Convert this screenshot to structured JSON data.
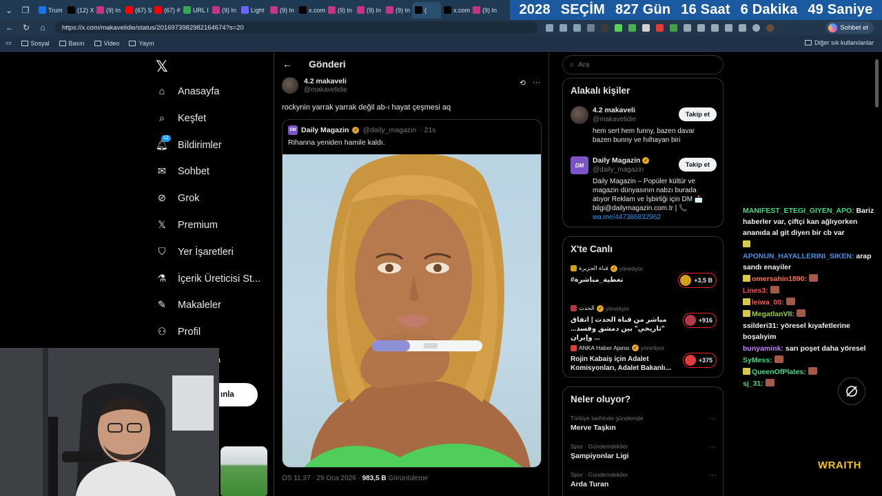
{
  "browser": {
    "tabs": [
      {
        "label": "Trum",
        "color": "#1a73e8",
        "icon": "news-icon"
      },
      {
        "label": "(12) X",
        "color": "#000000",
        "icon": "x-icon"
      },
      {
        "label": "(9) In",
        "color": "#c13584",
        "icon": "instagram-icon"
      },
      {
        "label": "(67) S",
        "color": "#ff0000",
        "icon": "youtube-icon"
      },
      {
        "label": "(67) #",
        "color": "#ff0000",
        "icon": "youtube-icon"
      },
      {
        "label": "URL I",
        "color": "#34a853",
        "icon": "url-icon"
      },
      {
        "label": "(9) In",
        "color": "#c13584",
        "icon": "instagram-icon"
      },
      {
        "label": "Light",
        "color": "#6c63ff",
        "icon": "pen-icon"
      },
      {
        "label": "(9) In",
        "color": "#c13584",
        "icon": "instagram-icon"
      },
      {
        "label": "x.com",
        "color": "#000000",
        "icon": "x-icon"
      },
      {
        "label": "(9) In",
        "color": "#c13584",
        "icon": "instagram-icon"
      },
      {
        "label": "(9) In",
        "color": "#c13584",
        "icon": "instagram-icon"
      },
      {
        "label": "(9) In",
        "color": "#c13584",
        "icon": "instagram-icon"
      },
      {
        "label": "(",
        "color": "#000000",
        "icon": "x-icon",
        "active": true
      },
      {
        "label": "x.com",
        "color": "#000000",
        "icon": "x-icon"
      },
      {
        "label": "(9) In",
        "color": "#c13584",
        "icon": "instagram-icon"
      }
    ],
    "countdown": {
      "year": "2028",
      "label": "SEÇİM",
      "days": "827 Gün",
      "hours": "16 Saat",
      "minutes": "6 Dakika",
      "seconds": "49 Saniye"
    },
    "url": "https://x.com/makavelidie/status/2016973982982164674?s=20",
    "chat_button": "Sohbet et",
    "bookmarks": [
      "Sosyal",
      "Basın",
      "Video",
      "Yayın"
    ],
    "other_bookmarks": "Diğer sık kullanılanlar"
  },
  "sidebar": {
    "items": [
      {
        "label": "Anasayfa",
        "icon": "home-icon"
      },
      {
        "label": "Keşfet",
        "icon": "search-icon"
      },
      {
        "label": "Bildirimler",
        "icon": "bell-icon",
        "badge": "12"
      },
      {
        "label": "Sohbet",
        "icon": "mail-icon"
      },
      {
        "label": "Grok",
        "icon": "grok-icon"
      },
      {
        "label": "Premium",
        "icon": "x-icon"
      },
      {
        "label": "Yer İşaretleri",
        "icon": "bookmark-icon"
      },
      {
        "label": "İçerik Üreticisi St...",
        "icon": "flask-icon"
      },
      {
        "label": "Makaleler",
        "icon": "article-icon"
      },
      {
        "label": "Profil",
        "icon": "person-icon"
      }
    ],
    "account_tail": "a",
    "post_button_tail": "ınla"
  },
  "post": {
    "header_title": "Gönderi",
    "author_name": "4.2 makaveli",
    "author_handle": "@makavelidie",
    "text": "rockynin yarrak yarrak değil ab-ı hayat çeşmesi aq",
    "quote": {
      "name": "Daily Magazin",
      "handle": "@daily_magazin",
      "time": "· 21s",
      "text": "Rihanna yeniden hamile kaldı.",
      "logo": "DM"
    },
    "meta_time": "ÖS 11:37 · 29 Oca 2026 ·",
    "views": "983,5 B",
    "views_label": "Görüntüleme"
  },
  "right": {
    "search_placeholder": "Ara",
    "related_title": "Alakalı kişiler",
    "people": [
      {
        "name": "4.2 makaveli",
        "handle": "@makavelidie",
        "bio": "hem sert hem funny, bazen davar bazen bunny ve hılhayan biri",
        "follow": "Takip et"
      },
      {
        "name": "Daily Magazin",
        "handle": "@daily_magazin",
        "bio": "Daily Magazin – Popüler kültür ve magazin dünyasının nabzı burada atıyor Reklam ve İşbirliği için DM 📩 bilgi@dailymagazin.com.tr | 📞",
        "link": "wa.me/447386832962",
        "follow": "Takip et"
      }
    ],
    "live_title": "X'te Canlı",
    "live": [
      {
        "host": "قناة الجزيرة",
        "role": "yönetiyor",
        "title": "#تغطية_مباشرة",
        "count": "+3,5 B",
        "color": "#d4a017"
      },
      {
        "host": "الحدث",
        "role": "yönetiyor",
        "title": "مباشر من قناة الحدث | اتفاق \"تاريخي\" بين دمشق وقسد... وإيران ...",
        "count": "+916",
        "color": "#b23a48"
      },
      {
        "host": "ANKA Haber Ajansı",
        "role": "yönetiyor",
        "title": "Rojin Kabaiş için Adalet Komisyonları, Adalet Bakanlı...",
        "count": "+375",
        "color": "#e23b3b"
      }
    ],
    "trends_title": "Neler oluyor?",
    "trends": [
      {
        "category": "Türkiye tarihinde gündemde",
        "name": "Merve Taşkın"
      },
      {
        "category": "Spor · Gündemdekiler",
        "name": "Şampiyonlar Ligi"
      },
      {
        "category": "Spor · Gündemdekiler",
        "name": "Arda Turan"
      }
    ]
  },
  "stream_chat": [
    {
      "user": "MANIFEST_ETEGI_GIYEN_APO:",
      "color": "#3ddc84",
      "text": " Bariz haberler var, çiftçi kan ağlıyorken ananıda al git diyen bir cb var",
      "icon": false,
      "emote": false
    },
    {
      "user": "",
      "color": "#ffffff",
      "text": "",
      "icon": true,
      "emote": false
    },
    {
      "user": "APONUN_HAYALLERINI_SIKEN:",
      "color": "#4a90e2",
      "text": " arap sandı enayiler",
      "icon": false,
      "emote": false
    },
    {
      "user": "omersahin1890:",
      "color": "#ff7043",
      "text": "",
      "icon": true,
      "emote": true
    },
    {
      "user": "Lines3:",
      "color": "#ff4d4d",
      "text": "",
      "icon": false,
      "emote": true
    },
    {
      "user": "leiwa_00:",
      "color": "#ff5252",
      "text": "",
      "icon": true,
      "emote": true
    },
    {
      "user": "MegatlanVII:",
      "color": "#9acd32",
      "text": "",
      "icon": true,
      "emote": true
    },
    {
      "user": "ssilderi31:",
      "color": "#f0f0f0",
      "text": " yöresel kıyafetlerine boşalıyim",
      "icon": false,
      "emote": false
    },
    {
      "user": "bunyamink:",
      "color": "#c77dff",
      "text": " sarı poşet daha yöresel",
      "icon": false,
      "emote": false
    },
    {
      "user": "SyMess:",
      "color": "#3ddc84",
      "text": "",
      "icon": false,
      "emote": true
    },
    {
      "user": "QueenOfPlates:",
      "color": "#3ddc84",
      "text": "",
      "icon": true,
      "emote": true
    },
    {
      "user": "sj_31:",
      "color": "#3ddc84",
      "text": "",
      "icon": false,
      "emote": true
    }
  ],
  "overlay": {
    "wraith_label": "WRAITH"
  }
}
